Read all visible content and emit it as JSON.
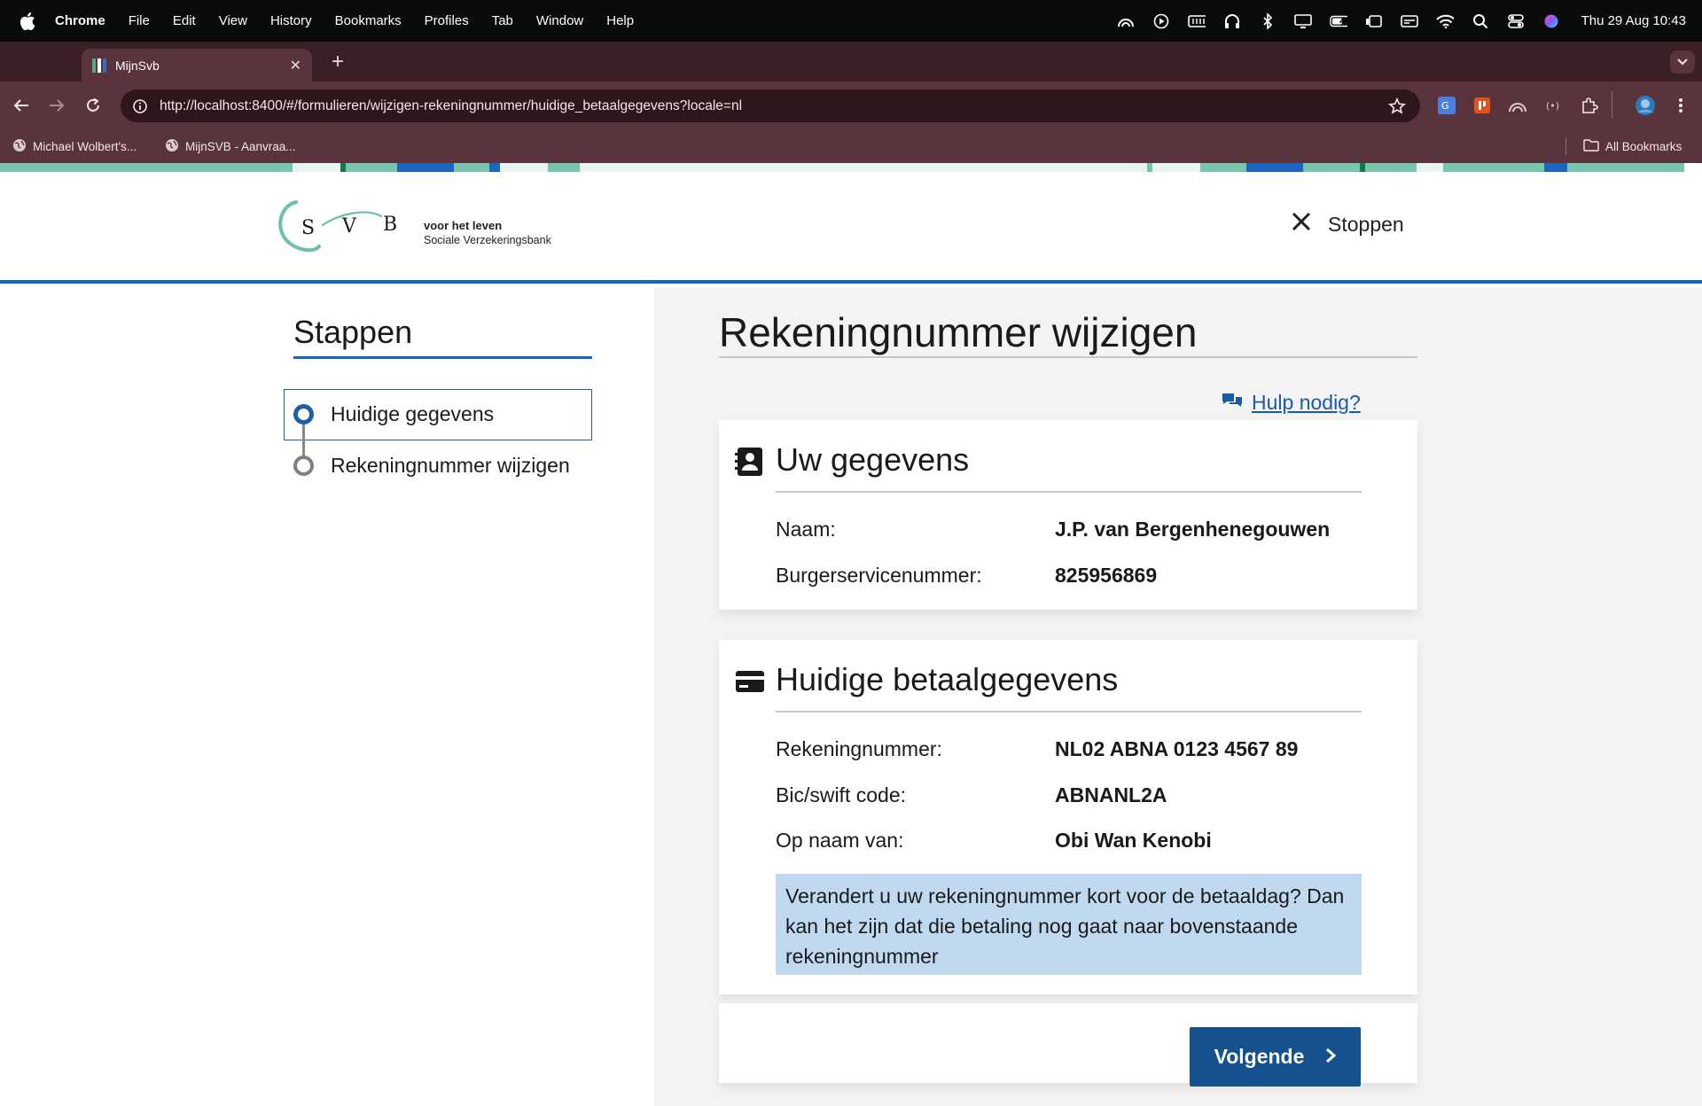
{
  "menubar": {
    "app_name": "Chrome",
    "menus": [
      "File",
      "Edit",
      "View",
      "History",
      "Bookmarks",
      "Profiles",
      "Tab",
      "Window",
      "Help"
    ],
    "clock": "Thu 29 Aug  10:43"
  },
  "browser": {
    "tab_title": "MijnSvb",
    "url": "http://localhost:8400/#/formulieren/wijzigen-rekeningnummer/huidige_betaalgegevens?locale=nl",
    "bookmarks": [
      "Michael Wolbert's...",
      "MijnSVB - Aanvraa..."
    ],
    "all_bookmarks": "All Bookmarks"
  },
  "header": {
    "logo_letters": [
      "S",
      "V",
      "B"
    ],
    "logo_tagline": "voor het leven",
    "logo_org": "Sociale Verzekeringsbank",
    "stop_label": "Stoppen"
  },
  "steps": {
    "title": "Stappen",
    "items": [
      {
        "label": "Huidige gegevens",
        "state": "active"
      },
      {
        "label": "Rekeningnummer wijzigen",
        "state": "todo"
      }
    ]
  },
  "main": {
    "title": "Rekeningnummer wijzigen",
    "help_label": "Hulp nodig?",
    "personal": {
      "title": "Uw gegevens",
      "rows": [
        {
          "label": "Naam:",
          "value": "J.P. van Bergenhenegouwen"
        },
        {
          "label": "Burgerservicenummer:",
          "value": "825956869"
        }
      ]
    },
    "payment": {
      "title": "Huidige betaalgegevens",
      "rows": [
        {
          "label": "Rekeningnummer:",
          "value": "NL02 ABNA 0123 4567 89"
        },
        {
          "label": "Bic/swift code:",
          "value": "ABNANL2A"
        },
        {
          "label": "Op naam van:",
          "value": "Obi Wan Kenobi"
        }
      ],
      "notice": "Verandert u uw rekeningnummer kort voor de betaaldag? Dan kan het zijn dat die betaling nog gaat naar bovenstaande rekeningnummer"
    },
    "next_label": "Volgende"
  },
  "colors": {
    "primary": "#1565b8",
    "button": "#15508f",
    "notice_bg": "#c1d9ef",
    "browser_frame": "#5a343c"
  }
}
